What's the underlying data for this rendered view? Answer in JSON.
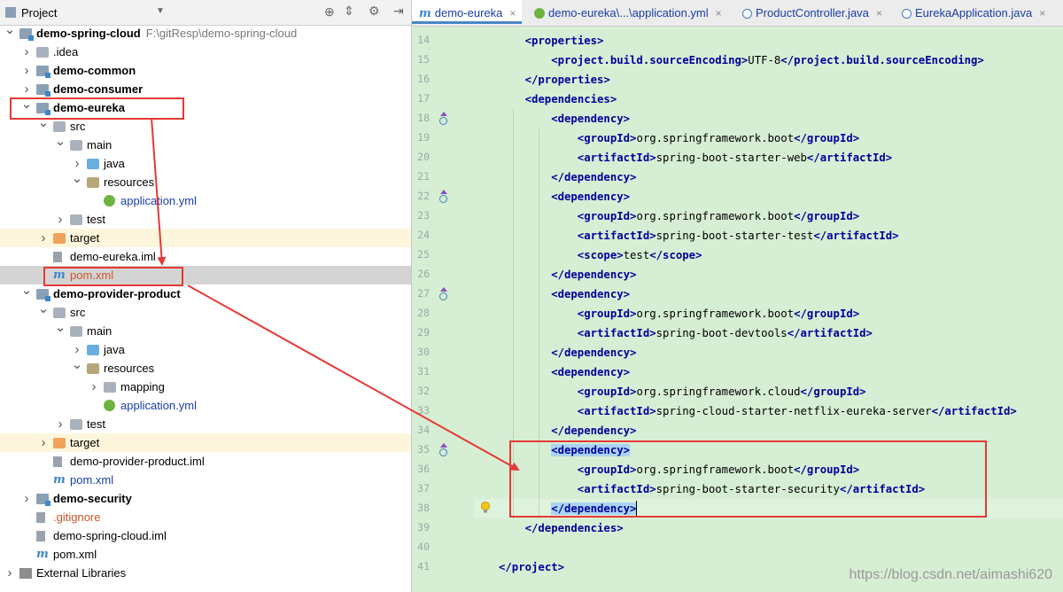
{
  "project_panel": {
    "title": "Project",
    "tree": [
      {
        "depth": 0,
        "arrow": "v",
        "icon": "module",
        "label": "demo-spring-cloud",
        "bold": true,
        "path": "F:\\gitResp\\demo-spring-cloud"
      },
      {
        "depth": 1,
        "arrow": ">",
        "icon": "folder-gray",
        "label": ".idea"
      },
      {
        "depth": 1,
        "arrow": ">",
        "icon": "module",
        "label": "demo-common",
        "bold": true
      },
      {
        "depth": 1,
        "arrow": ">",
        "icon": "module",
        "label": "demo-consumer",
        "bold": true
      },
      {
        "depth": 1,
        "arrow": "v",
        "icon": "module",
        "label": "demo-eureka",
        "bold": true
      },
      {
        "depth": 2,
        "arrow": "v",
        "icon": "folder-gray",
        "label": "src"
      },
      {
        "depth": 3,
        "arrow": "v",
        "icon": "folder-gray",
        "label": "main"
      },
      {
        "depth": 4,
        "arrow": ">",
        "icon": "folder-blue",
        "label": "java"
      },
      {
        "depth": 4,
        "arrow": "v",
        "icon": "resources",
        "label": "resources"
      },
      {
        "depth": 5,
        "arrow": "",
        "icon": "spring",
        "label": "application.yml",
        "color": "blue"
      },
      {
        "depth": 3,
        "arrow": ">",
        "icon": "folder-gray",
        "label": "test"
      },
      {
        "depth": 2,
        "arrow": ">",
        "icon": "folder-orange",
        "label": "target",
        "band": true
      },
      {
        "depth": 2,
        "arrow": "",
        "icon": "file",
        "label": "demo-eureka.iml"
      },
      {
        "depth": 2,
        "arrow": "",
        "icon": "maven",
        "label": "pom.xml",
        "color": "orange",
        "selected": true
      },
      {
        "depth": 1,
        "arrow": "v",
        "icon": "module",
        "label": "demo-provider-product",
        "bold": true
      },
      {
        "depth": 2,
        "arrow": "v",
        "icon": "folder-gray",
        "label": "src"
      },
      {
        "depth": 3,
        "arrow": "v",
        "icon": "folder-gray",
        "label": "main"
      },
      {
        "depth": 4,
        "arrow": ">",
        "icon": "folder-blue",
        "label": "java"
      },
      {
        "depth": 4,
        "arrow": "v",
        "icon": "resources",
        "label": "resources"
      },
      {
        "depth": 5,
        "arrow": ">",
        "icon": "folder-gray",
        "label": "mapping"
      },
      {
        "depth": 5,
        "arrow": "",
        "icon": "spring",
        "label": "application.yml",
        "color": "blue"
      },
      {
        "depth": 3,
        "arrow": ">",
        "icon": "folder-gray",
        "label": "test"
      },
      {
        "depth": 2,
        "arrow": ">",
        "icon": "folder-orange",
        "label": "target",
        "band": true
      },
      {
        "depth": 2,
        "arrow": "",
        "icon": "file",
        "label": "demo-provider-product.iml"
      },
      {
        "depth": 2,
        "arrow": "",
        "icon": "maven",
        "label": "pom.xml",
        "color": "blue"
      },
      {
        "depth": 1,
        "arrow": ">",
        "icon": "module",
        "label": "demo-security",
        "bold": true
      },
      {
        "depth": 1,
        "arrow": "",
        "icon": "file",
        "label": ".gitignore",
        "color": "orange"
      },
      {
        "depth": 1,
        "arrow": "",
        "icon": "file",
        "label": "demo-spring-cloud.iml"
      },
      {
        "depth": 1,
        "arrow": "",
        "icon": "maven",
        "label": "pom.xml"
      },
      {
        "depth": 0,
        "arrow": ">",
        "icon": "library",
        "label": "External Libraries"
      }
    ]
  },
  "tabs": [
    {
      "label": "demo-eureka",
      "icon": "maven",
      "active": true
    },
    {
      "label": "demo-eureka\\...\\application.yml",
      "icon": "spring"
    },
    {
      "label": "ProductController.java",
      "icon": "class"
    },
    {
      "label": "EurekaApplication.java",
      "icon": "class"
    }
  ],
  "maven_icon_glyph": "m",
  "close_glyph": "×",
  "editor": {
    "lines": [
      {
        "n": "14",
        "indent": 1,
        "parts": [
          [
            "t",
            "<properties>"
          ]
        ]
      },
      {
        "n": "15",
        "indent": 2,
        "parts": [
          [
            "t",
            "<project.build.sourceEncoding>"
          ],
          [
            "x",
            "UTF-8"
          ],
          [
            "t",
            "</project.build.sourceEncoding>"
          ]
        ]
      },
      {
        "n": "16",
        "indent": 1,
        "parts": [
          [
            "t",
            "</properties>"
          ]
        ]
      },
      {
        "n": "17",
        "indent": 1,
        "parts": [
          [
            "t",
            "<dependencies>"
          ]
        ]
      },
      {
        "n": "18",
        "indent": 2,
        "parts": [
          [
            "t",
            "<dependency>"
          ]
        ],
        "mark": true
      },
      {
        "n": "19",
        "indent": 3,
        "parts": [
          [
            "t",
            "<groupId>"
          ],
          [
            "x",
            "org.springframework.boot"
          ],
          [
            "t",
            "</groupId>"
          ]
        ]
      },
      {
        "n": "20",
        "indent": 3,
        "parts": [
          [
            "t",
            "<artifactId>"
          ],
          [
            "x",
            "spring-boot-starter-web"
          ],
          [
            "t",
            "</artifactId>"
          ]
        ]
      },
      {
        "n": "21",
        "indent": 2,
        "parts": [
          [
            "t",
            "</dependency>"
          ]
        ]
      },
      {
        "n": "22",
        "indent": 2,
        "parts": [
          [
            "t",
            "<dependency>"
          ]
        ],
        "mark": true
      },
      {
        "n": "23",
        "indent": 3,
        "parts": [
          [
            "t",
            "<groupId>"
          ],
          [
            "x",
            "org.springframework.boot"
          ],
          [
            "t",
            "</groupId>"
          ]
        ]
      },
      {
        "n": "24",
        "indent": 3,
        "parts": [
          [
            "t",
            "<artifactId>"
          ],
          [
            "x",
            "spring-boot-starter-test"
          ],
          [
            "t",
            "</artifactId>"
          ]
        ]
      },
      {
        "n": "25",
        "indent": 3,
        "parts": [
          [
            "t",
            "<scope>"
          ],
          [
            "x",
            "test"
          ],
          [
            "t",
            "</scope>"
          ]
        ]
      },
      {
        "n": "26",
        "indent": 2,
        "parts": [
          [
            "t",
            "</dependency>"
          ]
        ]
      },
      {
        "n": "27",
        "indent": 2,
        "parts": [
          [
            "t",
            "<dependency>"
          ]
        ],
        "mark": true
      },
      {
        "n": "28",
        "indent": 3,
        "parts": [
          [
            "t",
            "<groupId>"
          ],
          [
            "x",
            "org.springframework.boot"
          ],
          [
            "t",
            "</groupId>"
          ]
        ]
      },
      {
        "n": "29",
        "indent": 3,
        "parts": [
          [
            "t",
            "<artifactId>"
          ],
          [
            "x",
            "spring-boot-devtools"
          ],
          [
            "t",
            "</artifactId>"
          ]
        ]
      },
      {
        "n": "30",
        "indent": 2,
        "parts": [
          [
            "t",
            "</dependency>"
          ]
        ]
      },
      {
        "n": "31",
        "indent": 2,
        "parts": [
          [
            "t",
            "<dependency>"
          ]
        ]
      },
      {
        "n": "32",
        "indent": 3,
        "parts": [
          [
            "t",
            "<groupId>"
          ],
          [
            "x",
            "org.springframework.cloud"
          ],
          [
            "t",
            "</groupId>"
          ]
        ]
      },
      {
        "n": "33",
        "indent": 3,
        "parts": [
          [
            "t",
            "<artifactId>"
          ],
          [
            "x",
            "spring-cloud-starter-netflix-eureka-server"
          ],
          [
            "t",
            "</artifactId>"
          ]
        ]
      },
      {
        "n": "34",
        "indent": 2,
        "parts": [
          [
            "t",
            "</dependency>"
          ]
        ]
      },
      {
        "n": "35",
        "indent": 2,
        "parts": [
          [
            "h",
            "<dependency>"
          ]
        ],
        "mark": true
      },
      {
        "n": "36",
        "indent": 3,
        "parts": [
          [
            "t",
            "<groupId>"
          ],
          [
            "x",
            "org.springframework.boot"
          ],
          [
            "t",
            "</groupId>"
          ]
        ]
      },
      {
        "n": "37",
        "indent": 3,
        "parts": [
          [
            "t",
            "<artifactId>"
          ],
          [
            "x",
            "spring-boot-starter-security"
          ],
          [
            "t",
            "</artifactId>"
          ]
        ]
      },
      {
        "n": "38",
        "indent": 2,
        "parts": [
          [
            "h",
            "</dependency>"
          ]
        ],
        "caret": true
      },
      {
        "n": "39",
        "indent": 1,
        "parts": [
          [
            "t",
            "</dependencies>"
          ]
        ]
      },
      {
        "n": "40",
        "indent": 0,
        "parts": []
      },
      {
        "n": "41",
        "indent": 0,
        "parts": [
          [
            "t",
            "</project>"
          ]
        ]
      }
    ]
  },
  "watermark": "https://blog.csdn.net/aimashi620",
  "colors": {
    "annotation": "#e53935",
    "tag": "#00009d",
    "editor_bg": "#d6eed3"
  }
}
